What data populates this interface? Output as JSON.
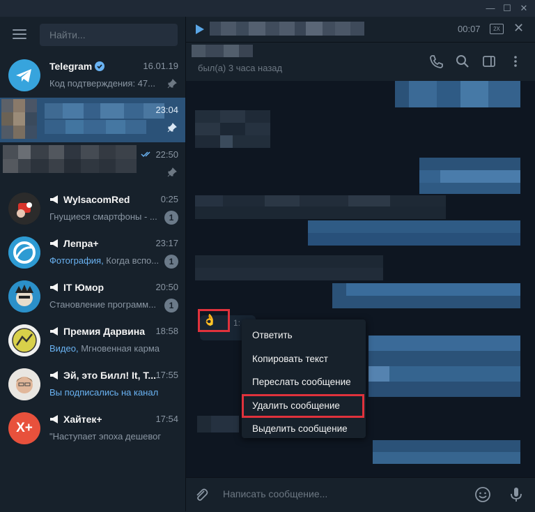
{
  "window": {
    "minimize": "—",
    "maximize": "☐",
    "close": "✕"
  },
  "sidebar": {
    "search_placeholder": "Найти...",
    "chats": [
      {
        "name": "Telegram",
        "time": "16.01.19",
        "preview": "Код подтверждения: 47...",
        "verified": true,
        "pinned": true
      },
      {
        "name": "",
        "time": "23:04",
        "preview": "",
        "pinned": true,
        "active": true
      },
      {
        "name": "",
        "time": "22:50",
        "preview": "",
        "pinned": true,
        "read": true
      },
      {
        "name": "WylsacomRed",
        "time": "0:25",
        "preview": "Гнущиеся смартфоны - ...",
        "badge": "1",
        "channel": true
      },
      {
        "name": "Лепра+",
        "time": "23:17",
        "preview_highlight": "Фотография,",
        "preview": " Когда вспо...",
        "badge": "1",
        "channel": true
      },
      {
        "name": "IT Юмор",
        "time": "20:50",
        "preview": "Становление программ...",
        "badge": "1",
        "channel": true
      },
      {
        "name": "Премия Дарвина",
        "time": "18:58",
        "preview_highlight": "Видео,",
        "preview": " Мгновенная карма з...",
        "channel": true
      },
      {
        "name": "Эй, это Билл! It, T...",
        "time": "17:55",
        "preview_highlight": "Вы подписались на канал",
        "preview": "",
        "channel": true
      },
      {
        "name": "Хайтек+",
        "time": "17:54",
        "preview": "\"Наступает эпоха дешевого...",
        "channel": true,
        "avatar_text": "X+"
      }
    ]
  },
  "player": {
    "time": "00:07",
    "speed": "2X"
  },
  "header": {
    "status": "был(а) 3 часа назад"
  },
  "message": {
    "emoji": "👌",
    "time_partial": "1:"
  },
  "context_menu": {
    "items": [
      "Ответить",
      "Копировать текст",
      "Переслать сообщение",
      "Удалить сообщение",
      "Выделить сообщение"
    ]
  },
  "input": {
    "placeholder": "Написать сообщение..."
  },
  "colors": {
    "accent": "#2b5278",
    "highlight_box": "#e0323c",
    "link": "#6ab3f3"
  }
}
